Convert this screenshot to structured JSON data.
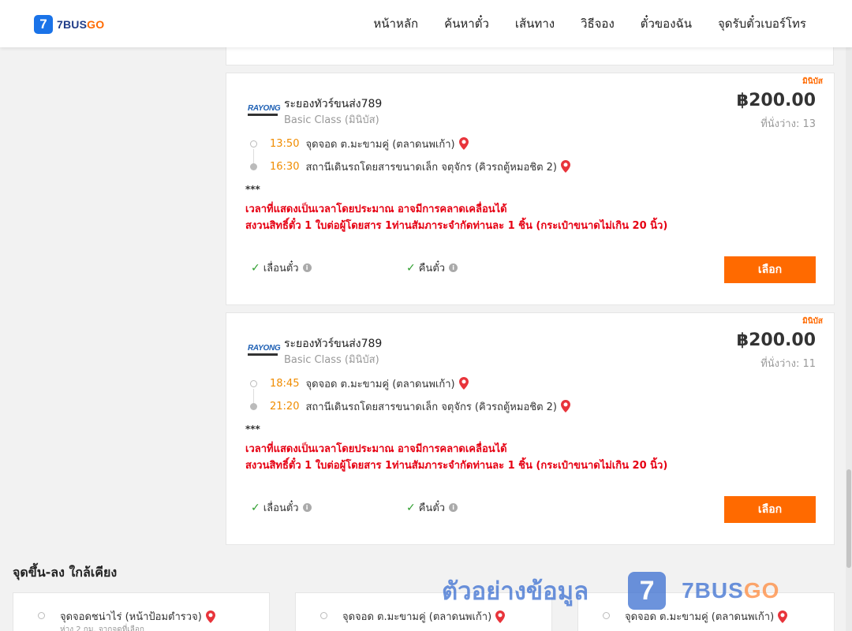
{
  "header": {
    "logo_mark": "7",
    "logo_text_a": "7BUS",
    "logo_text_b": "GO",
    "nav": [
      "หน้าหลัก",
      "ค้นหาตั๋ว",
      "เส้นทาง",
      "วิธีจอง",
      "ตั๋วของฉัน",
      "จุดรับตั๋วเบอร์โทร"
    ]
  },
  "trips": [
    {
      "tag": "มินิบัส",
      "operator_logo": "RAYONG",
      "operator_name": "ระยองทัวร์ขนส่ง789",
      "class": "Basic Class (มินิบัส)",
      "price": "฿200.00",
      "seats": "ที่นั่งว่าง: 13",
      "depart_time": "13:50",
      "depart_place": "จุดจอด ต.มะขามคู่ (ตลาดนพเก้า)",
      "arrive_time": "16:30",
      "arrive_place": "สถานีเดินรถโดยสารขนาดเล็ก จตุจักร (คิวรถตู้หมอชิต 2)",
      "stars": "***",
      "notice_1": "เวลาที่แสดงเป็นเวลาโดยประมาณ อาจมีการคลาดเคลื่อนได้",
      "notice_2": "สงวนสิทธิ์ตั๋ว 1 ใบต่อผู้โดยสาร 1ท่านสัมภาระจำกัดท่านละ 1 ชิ้น (กระเป๋าขนาดไม่เกิน 20 นิ้ว)",
      "feature_1": "เลื่อนตั๋ว",
      "feature_2": "คืนตั๋ว",
      "select_label": "เลือก"
    },
    {
      "tag": "มินิบัส",
      "operator_logo": "RAYONG",
      "operator_name": "ระยองทัวร์ขนส่ง789",
      "class": "Basic Class (มินิบัส)",
      "price": "฿200.00",
      "seats": "ที่นั่งว่าง: 11",
      "depart_time": "18:45",
      "depart_place": "จุดจอด ต.มะขามคู่ (ตลาดนพเก้า)",
      "arrive_time": "21:20",
      "arrive_place": "สถานีเดินรถโดยสารขนาดเล็ก จตุจักร (คิวรถตู้หมอชิต 2)",
      "stars": "***",
      "notice_1": "เวลาที่แสดงเป็นเวลาโดยประมาณ อาจมีการคลาดเคลื่อนได้",
      "notice_2": "สงวนสิทธิ์ตั๋ว 1 ใบต่อผู้โดยสาร 1ท่านสัมภาระจำกัดท่านละ 1 ชิ้น (กระเป๋าขนาดไม่เกิน 20 นิ้ว)",
      "feature_1": "เลื่อนตั๋ว",
      "feature_2": "คืนตั๋ว",
      "select_label": "เลือก"
    }
  ],
  "nearby": {
    "title": "จุดขึ้น-ลง ใกล้เคียง",
    "items": [
      {
        "name": "จุดจอดชน่าไร่ (หน้าป้อมตำรวจ)",
        "sub": "ห่าง 2 กม. จากจุดที่เลือก"
      },
      {
        "name": "จุดจอด ต.มะขามคู่ (ตลาดนพเก้า)",
        "sub": ""
      },
      {
        "name": "จุดจอด ต.มะขามคู่ (ตลาดนพเก้า)",
        "sub": ""
      }
    ]
  },
  "watermark": {
    "text": "ตัวอย่างข้อมูล",
    "mark": "7",
    "brand_a": "7BUS",
    "brand_b": "GO"
  },
  "colors": {
    "accent": "#ff6a00",
    "notice": "#e60012",
    "time": "#f08c00",
    "brand_blue": "#1a73e8"
  }
}
